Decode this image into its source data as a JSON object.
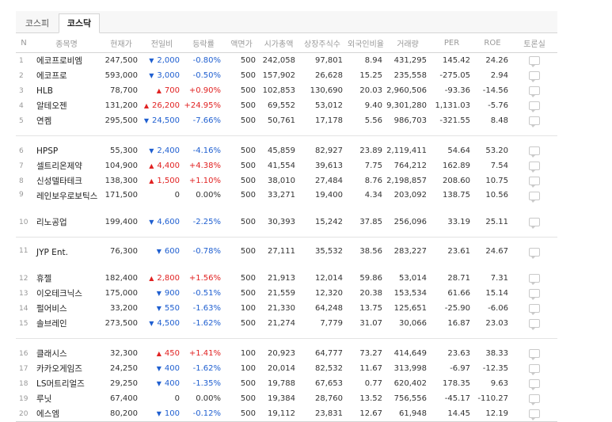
{
  "tabs": [
    {
      "label": "코스피"
    },
    {
      "label": "코스닥"
    }
  ],
  "columns": [
    "N",
    "종목명",
    "현재가",
    "전일비",
    "등락률",
    "액면가",
    "시가총액",
    "상장주식수",
    "외국인비율",
    "거래량",
    "PER",
    "ROE",
    "토론실"
  ],
  "rows": [
    {
      "n": "1",
      "name": "에코프로비엠",
      "price": "247,500",
      "dir": "down",
      "change": "2,000",
      "rate": "-0.80%",
      "par": "500",
      "cap": "242,058",
      "shares": "97,801",
      "foreign": "8.94",
      "volume": "431,295",
      "per": "145.42",
      "roe": "24.26"
    },
    {
      "n": "2",
      "name": "에코프로",
      "price": "593,000",
      "dir": "down",
      "change": "3,000",
      "rate": "-0.50%",
      "par": "500",
      "cap": "157,902",
      "shares": "26,628",
      "foreign": "15.25",
      "volume": "235,558",
      "per": "-275.05",
      "roe": "2.94"
    },
    {
      "n": "3",
      "name": "HLB",
      "price": "78,700",
      "dir": "up",
      "change": "700",
      "rate": "+0.90%",
      "par": "500",
      "cap": "102,853",
      "shares": "130,690",
      "foreign": "20.03",
      "volume": "2,960,506",
      "per": "-93.36",
      "roe": "-14.56"
    },
    {
      "n": "4",
      "name": "알테오젠",
      "price": "131,200",
      "dir": "up",
      "change": "26,200",
      "rate": "+24.95%",
      "par": "500",
      "cap": "69,552",
      "shares": "53,012",
      "foreign": "9.40",
      "volume": "9,301,280",
      "per": "1,131.03",
      "roe": "-5.76"
    },
    {
      "n": "5",
      "name": "연켐",
      "price": "295,500",
      "dir": "down",
      "change": "24,500",
      "rate": "-7.66%",
      "par": "500",
      "cap": "50,761",
      "shares": "17,178",
      "foreign": "5.56",
      "volume": "986,703",
      "per": "-321.55",
      "roe": "8.48"
    },
    {
      "n": "6",
      "name": "HPSP",
      "price": "55,300",
      "dir": "down",
      "change": "2,400",
      "rate": "-4.16%",
      "par": "500",
      "cap": "45,859",
      "shares": "82,927",
      "foreign": "23.89",
      "volume": "2,119,411",
      "per": "54.64",
      "roe": "53.20"
    },
    {
      "n": "7",
      "name": "셀트리온제약",
      "price": "104,900",
      "dir": "up",
      "change": "4,400",
      "rate": "+4.38%",
      "par": "500",
      "cap": "41,554",
      "shares": "39,613",
      "foreign": "7.75",
      "volume": "764,212",
      "per": "162.89",
      "roe": "7.54"
    },
    {
      "n": "8",
      "name": "신성델타테크",
      "price": "138,300",
      "dir": "up",
      "change": "1,500",
      "rate": "+1.10%",
      "par": "500",
      "cap": "38,010",
      "shares": "27,484",
      "foreign": "8.76",
      "volume": "2,198,857",
      "per": "208.60",
      "roe": "10.75"
    },
    {
      "n": "9",
      "name": "레인보우로보틱스",
      "price": "171,500",
      "dir": "zero",
      "change": "0",
      "rate": "0.00%",
      "par": "500",
      "cap": "33,271",
      "shares": "19,400",
      "foreign": "4.34",
      "volume": "203,092",
      "per": "138.75",
      "roe": "10.56"
    },
    {
      "n": "10",
      "name": "리노공업",
      "price": "199,400",
      "dir": "down",
      "change": "4,600",
      "rate": "-2.25%",
      "par": "500",
      "cap": "30,393",
      "shares": "15,242",
      "foreign": "37.85",
      "volume": "256,096",
      "per": "33.19",
      "roe": "25.11"
    },
    {
      "n": "11",
      "name": "JYP Ent.",
      "price": "76,300",
      "dir": "down",
      "change": "600",
      "rate": "-0.78%",
      "par": "500",
      "cap": "27,111",
      "shares": "35,532",
      "foreign": "38.56",
      "volume": "283,227",
      "per": "23.61",
      "roe": "24.67"
    },
    {
      "n": "12",
      "name": "휴젤",
      "price": "182,400",
      "dir": "up",
      "change": "2,800",
      "rate": "+1.56%",
      "par": "500",
      "cap": "21,913",
      "shares": "12,014",
      "foreign": "59.86",
      "volume": "53,014",
      "per": "28.71",
      "roe": "7.31"
    },
    {
      "n": "13",
      "name": "이오테크닉스",
      "price": "175,000",
      "dir": "down",
      "change": "900",
      "rate": "-0.51%",
      "par": "500",
      "cap": "21,559",
      "shares": "12,320",
      "foreign": "20.38",
      "volume": "153,534",
      "per": "61.66",
      "roe": "15.14"
    },
    {
      "n": "14",
      "name": "펄어비스",
      "price": "33,200",
      "dir": "down",
      "change": "550",
      "rate": "-1.63%",
      "par": "100",
      "cap": "21,330",
      "shares": "64,248",
      "foreign": "13.75",
      "volume": "125,651",
      "per": "-25.90",
      "roe": "-6.06"
    },
    {
      "n": "15",
      "name": "솔브레인",
      "price": "273,500",
      "dir": "down",
      "change": "4,500",
      "rate": "-1.62%",
      "par": "500",
      "cap": "21,274",
      "shares": "7,779",
      "foreign": "31.07",
      "volume": "30,066",
      "per": "16.87",
      "roe": "23.03"
    },
    {
      "n": "16",
      "name": "클래시스",
      "price": "32,300",
      "dir": "up",
      "change": "450",
      "rate": "+1.41%",
      "par": "100",
      "cap": "20,923",
      "shares": "64,777",
      "foreign": "73.27",
      "volume": "414,649",
      "per": "23.63",
      "roe": "38.33"
    },
    {
      "n": "17",
      "name": "카카오게임즈",
      "price": "24,250",
      "dir": "down",
      "change": "400",
      "rate": "-1.62%",
      "par": "100",
      "cap": "20,014",
      "shares": "82,532",
      "foreign": "11.67",
      "volume": "313,998",
      "per": "-6.97",
      "roe": "-12.35"
    },
    {
      "n": "18",
      "name": "LS머트리얼즈",
      "price": "29,250",
      "dir": "down",
      "change": "400",
      "rate": "-1.35%",
      "par": "500",
      "cap": "19,788",
      "shares": "67,653",
      "foreign": "0.77",
      "volume": "620,402",
      "per": "178.35",
      "roe": "9.63"
    },
    {
      "n": "19",
      "name": "루닛",
      "price": "67,400",
      "dir": "zero",
      "change": "0",
      "rate": "0.00%",
      "par": "500",
      "cap": "19,384",
      "shares": "28,760",
      "foreign": "13.52",
      "volume": "756,556",
      "per": "-45.17",
      "roe": "-110.27"
    },
    {
      "n": "20",
      "name": "에스엠",
      "price": "80,200",
      "dir": "down",
      "change": "100",
      "rate": "-0.12%",
      "par": "500",
      "cap": "19,112",
      "shares": "23,831",
      "foreign": "12.67",
      "volume": "61,948",
      "per": "14.45",
      "roe": "12.19"
    }
  ],
  "colors": {
    "up": "#e12222",
    "down": "#1f5fd0"
  },
  "icons": {
    "up": "▲",
    "down": "▼",
    "discussion": "speech-bubble-icon"
  }
}
